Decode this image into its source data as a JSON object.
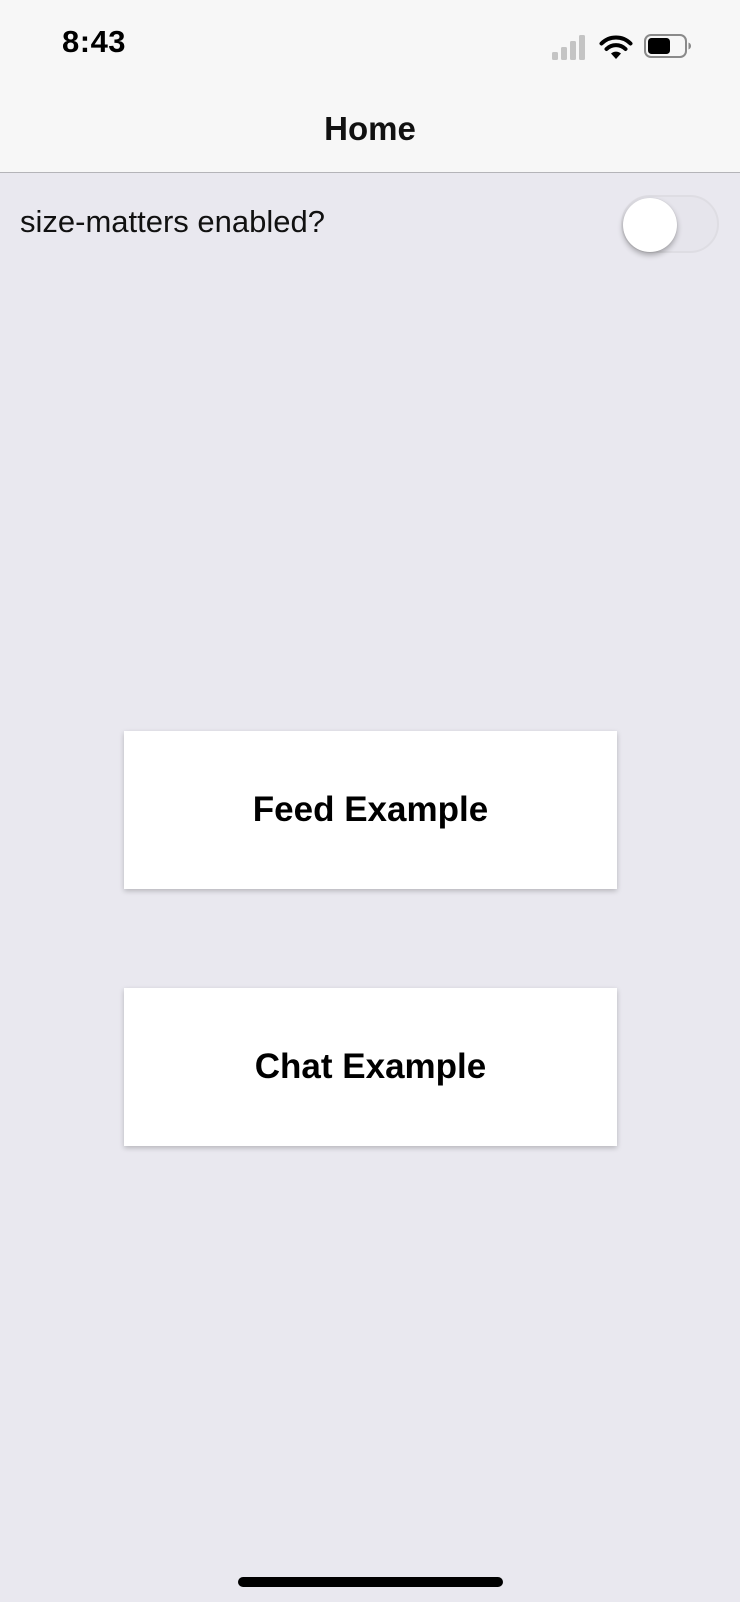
{
  "status_bar": {
    "time": "8:43",
    "icons": [
      "cellular-signal-icon",
      "wifi-icon",
      "battery-icon"
    ]
  },
  "nav_bar": {
    "title": "Home"
  },
  "settings": {
    "toggle_label": "size-matters enabled?",
    "toggle_on": false
  },
  "buttons": {
    "feed_label": "Feed Example",
    "chat_label": "Chat Example"
  },
  "colors": {
    "background": "#e9e8ef",
    "bar_background": "#f7f7f7",
    "button_background": "#ffffff",
    "text": "#000000"
  }
}
